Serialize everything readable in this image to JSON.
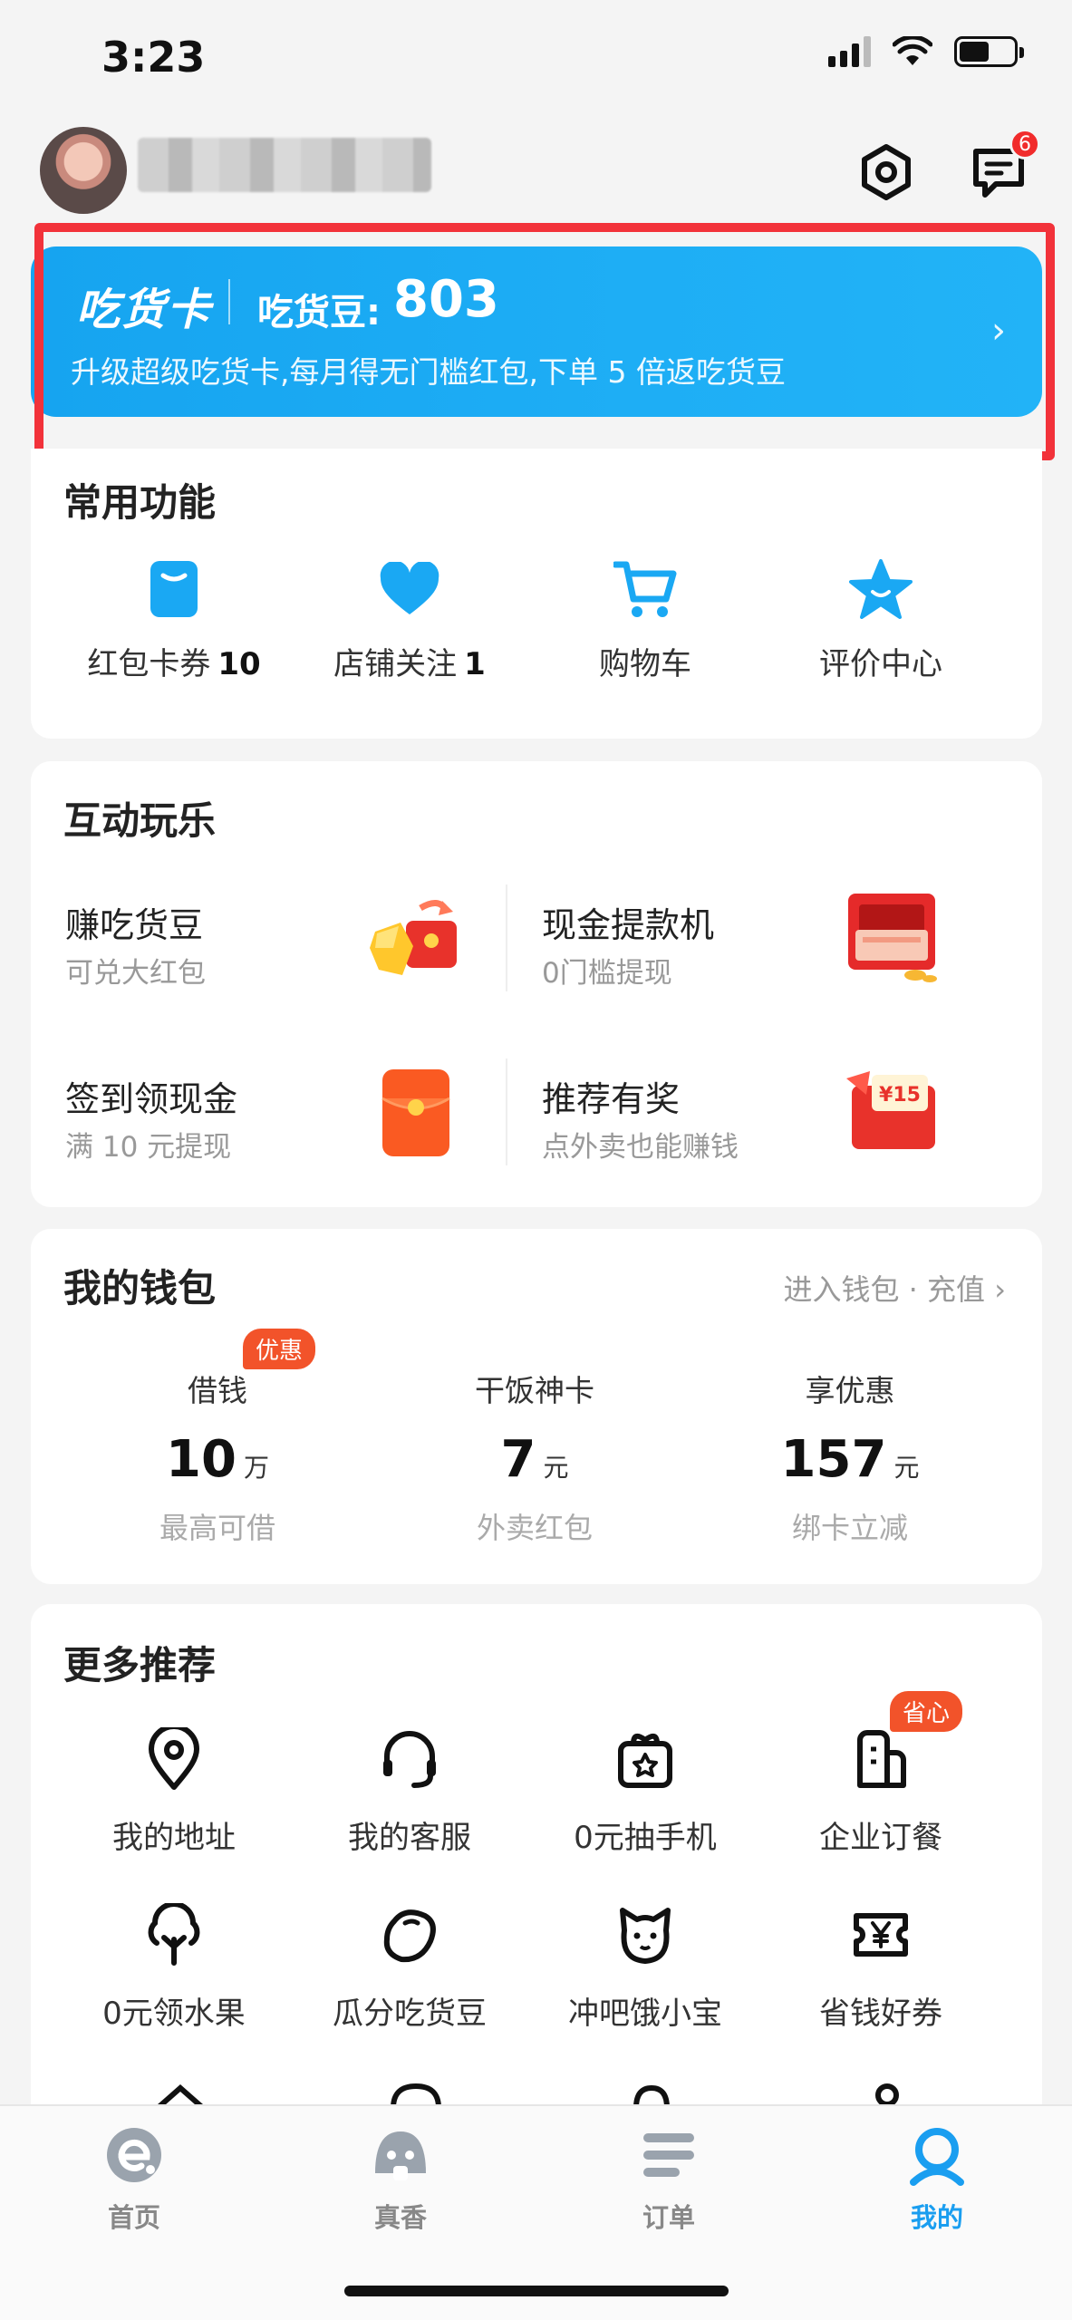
{
  "status_bar": {
    "time": "3:23"
  },
  "header": {
    "avatar": "user-avatar",
    "username": "",
    "settings_icon": "settings-hexagon-icon",
    "messages_icon": "message-bubble-icon",
    "messages_badge": "6"
  },
  "foodie_card": {
    "title": "吃货卡",
    "beans_label": "吃货豆:",
    "beans_value": "803",
    "description": "升级超级吃货卡,每月得无门槛红包,下单 5 倍返吃货豆",
    "arrow": "›",
    "highlight_color": "#f2323a"
  },
  "common_functions": {
    "title": "常用功能",
    "items": [
      {
        "label": "红包卡券",
        "count": "10",
        "icon": "coupon-icon"
      },
      {
        "label": "店铺关注",
        "count": "1",
        "icon": "heart-icon"
      },
      {
        "label": "购物车",
        "count": "",
        "icon": "cart-icon"
      },
      {
        "label": "评价中心",
        "count": "",
        "icon": "star-icon"
      }
    ]
  },
  "interactive_fun": {
    "title": "互动玩乐",
    "items": [
      {
        "name": "赚吃货豆",
        "sub": "可兑大红包",
        "icon": "beans-redpacket-icon"
      },
      {
        "name": "现金提款机",
        "sub": "0门槛提现",
        "icon": "cash-machine-icon"
      },
      {
        "name": "签到领现金",
        "sub": "满 10 元提现",
        "icon": "red-envelope-icon"
      },
      {
        "name": "推荐有奖",
        "sub": "点外卖也能赚钱",
        "icon": "reward-envelope-icon",
        "img_text": "¥15"
      }
    ]
  },
  "wallet": {
    "title": "我的钱包",
    "link": "进入钱包 · 充值 ›",
    "badge": "优惠",
    "items": [
      {
        "name": "借钱",
        "value": "10",
        "unit": "万",
        "sub": "最高可借"
      },
      {
        "name": "干饭神卡",
        "value": "7",
        "unit": "元",
        "sub": "外卖红包"
      },
      {
        "name": "享优惠",
        "value": "157",
        "unit": "元",
        "sub": "绑卡立减"
      }
    ]
  },
  "more": {
    "title": "更多推荐",
    "badge": "省心",
    "items": [
      {
        "label": "我的地址",
        "icon": "location-pin-icon"
      },
      {
        "label": "我的客服",
        "icon": "headset-icon"
      },
      {
        "label": "0元抽手机",
        "icon": "gift-box-icon"
      },
      {
        "label": "企业订餐",
        "icon": "building-icon"
      },
      {
        "label": "0元领水果",
        "icon": "fruit-tree-icon"
      },
      {
        "label": "瓜分吃货豆",
        "icon": "bean-icon"
      },
      {
        "label": "冲吧饿小宝",
        "icon": "pet-face-icon"
      },
      {
        "label": "省钱好券",
        "icon": "yen-ticket-icon"
      }
    ]
  },
  "tab_bar": {
    "tabs": [
      {
        "label": "首页",
        "icon": "home-e-icon",
        "active": false
      },
      {
        "label": "真香",
        "icon": "fragrant-icon",
        "active": false
      },
      {
        "label": "订单",
        "icon": "order-list-icon",
        "active": false
      },
      {
        "label": "我的",
        "icon": "profile-icon",
        "active": true
      }
    ],
    "active_color": "#1a9ef0"
  }
}
